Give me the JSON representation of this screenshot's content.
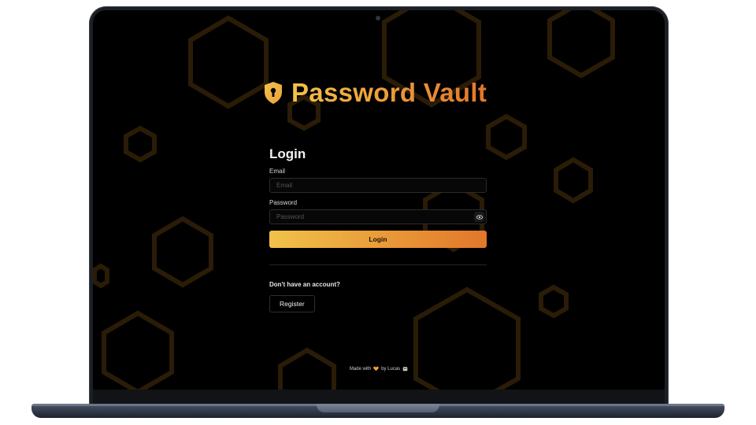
{
  "app": {
    "title": "Password Vault"
  },
  "login": {
    "heading": "Login",
    "email_label": "Email",
    "email_placeholder": "Email",
    "email_value": "",
    "password_label": "Password",
    "password_placeholder": "Password",
    "password_value": "",
    "submit_label": "Login"
  },
  "register": {
    "prompt": "Don't have an account?",
    "button_label": "Register"
  },
  "footer": {
    "made_with": "Made with",
    "made_with_icon": "heart-icon",
    "by": "by Lucas",
    "trailing_icon": "robot-icon"
  },
  "colors": {
    "accent_start": "#f3c14b",
    "accent_end": "#e2772a",
    "background": "#000000"
  }
}
